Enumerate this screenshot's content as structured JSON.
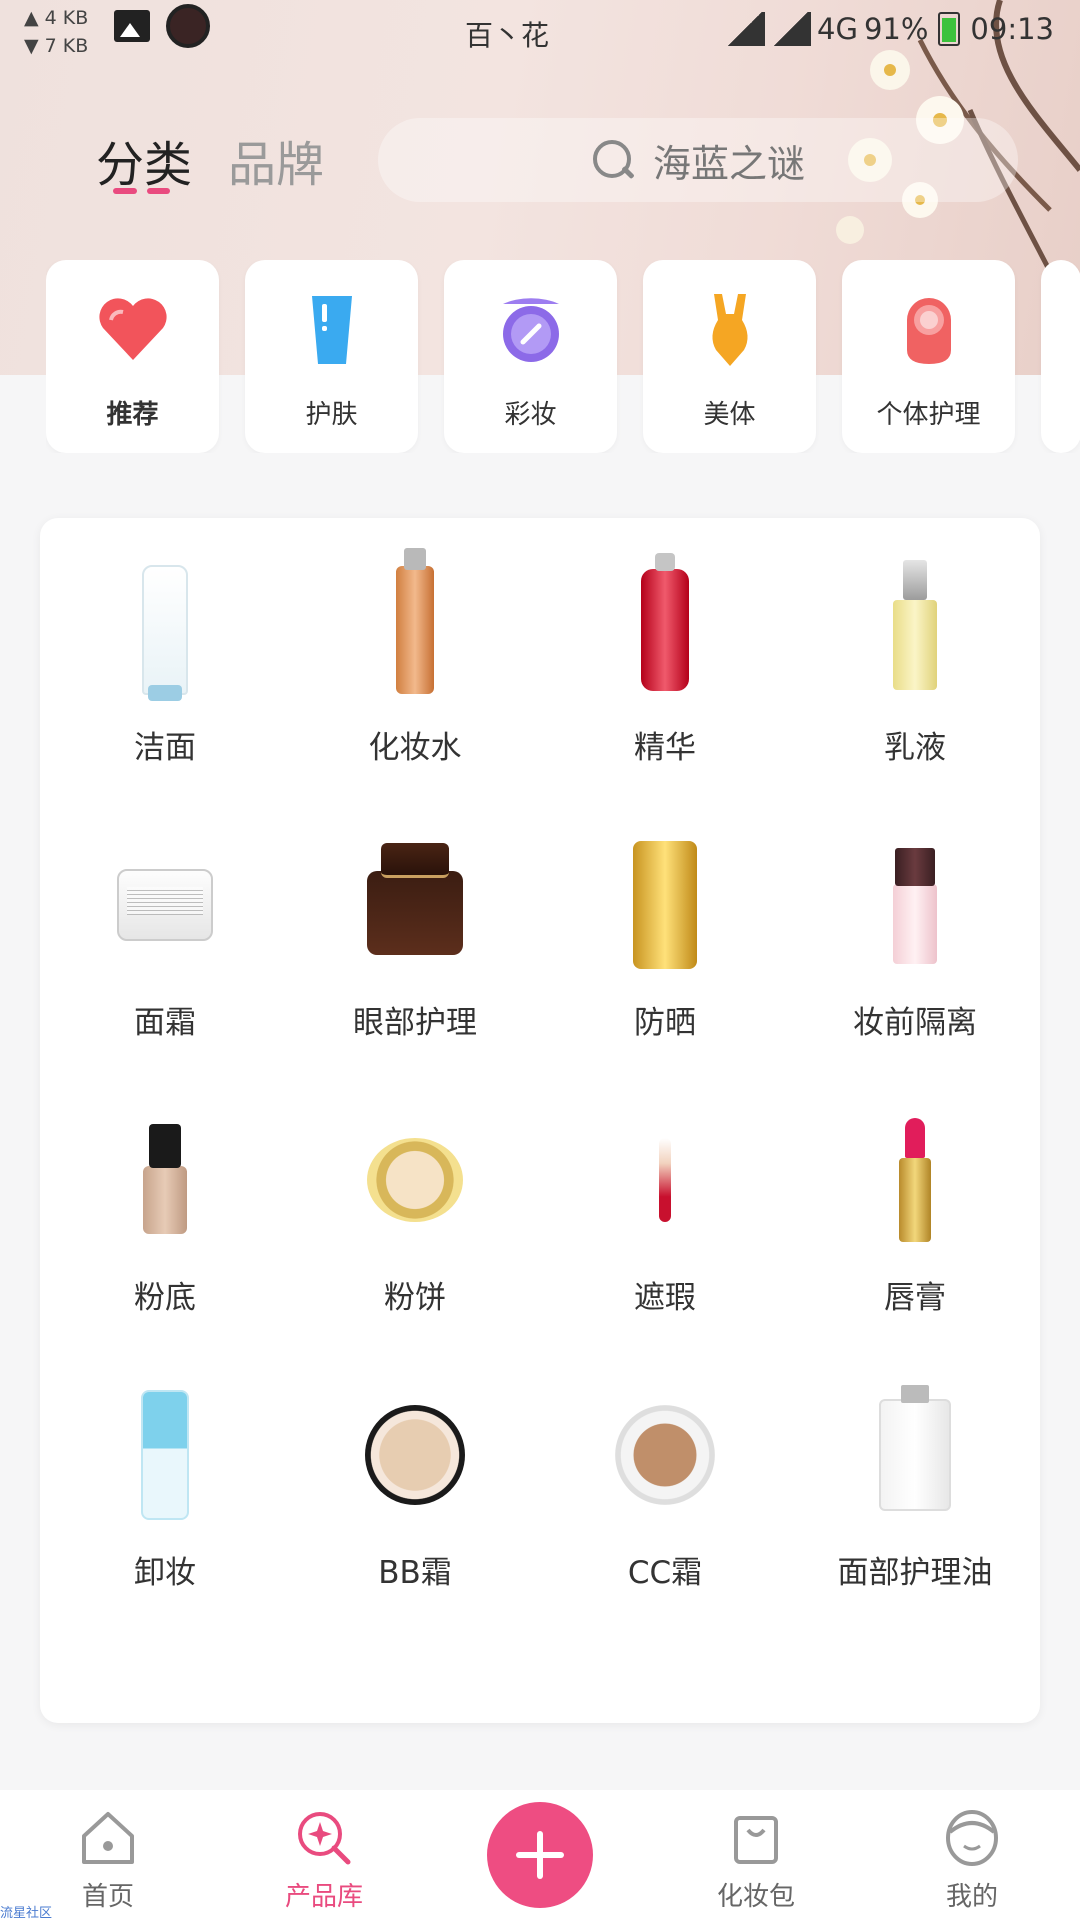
{
  "status_bar": {
    "upload_speed": "▲ 4 KB",
    "download_speed": "▼ 7 KB",
    "carrier_title": "百丶花",
    "network": "4G",
    "battery": "91%",
    "time": "09:13"
  },
  "header": {
    "tab_category": "分类",
    "tab_brand": "品牌",
    "search_placeholder": "海蓝之谜"
  },
  "categories": [
    {
      "label": "推荐",
      "icon": "heart-icon",
      "active": true
    },
    {
      "label": "护肤",
      "icon": "tube-icon"
    },
    {
      "label": "彩妆",
      "icon": "compact-icon"
    },
    {
      "label": "美体",
      "icon": "body-icon"
    },
    {
      "label": "个体护理",
      "icon": "personal-care-icon"
    }
  ],
  "products": [
    {
      "label": "洁面"
    },
    {
      "label": "化妆水"
    },
    {
      "label": "精华"
    },
    {
      "label": "乳液"
    },
    {
      "label": "面霜"
    },
    {
      "label": "眼部护理"
    },
    {
      "label": "防晒"
    },
    {
      "label": "妆前隔离"
    },
    {
      "label": "粉底"
    },
    {
      "label": "粉饼"
    },
    {
      "label": "遮瑕"
    },
    {
      "label": "唇膏"
    },
    {
      "label": "卸妆"
    },
    {
      "label": "BB霜"
    },
    {
      "label": "CC霜"
    },
    {
      "label": "面部护理油"
    }
  ],
  "bottom_nav": {
    "home": "首页",
    "library": "产品库",
    "bag": "化妆包",
    "mine": "我的"
  },
  "watermark": "流星社区",
  "colors": {
    "accent": "#e94b7f",
    "fab": "#ee4d82"
  }
}
